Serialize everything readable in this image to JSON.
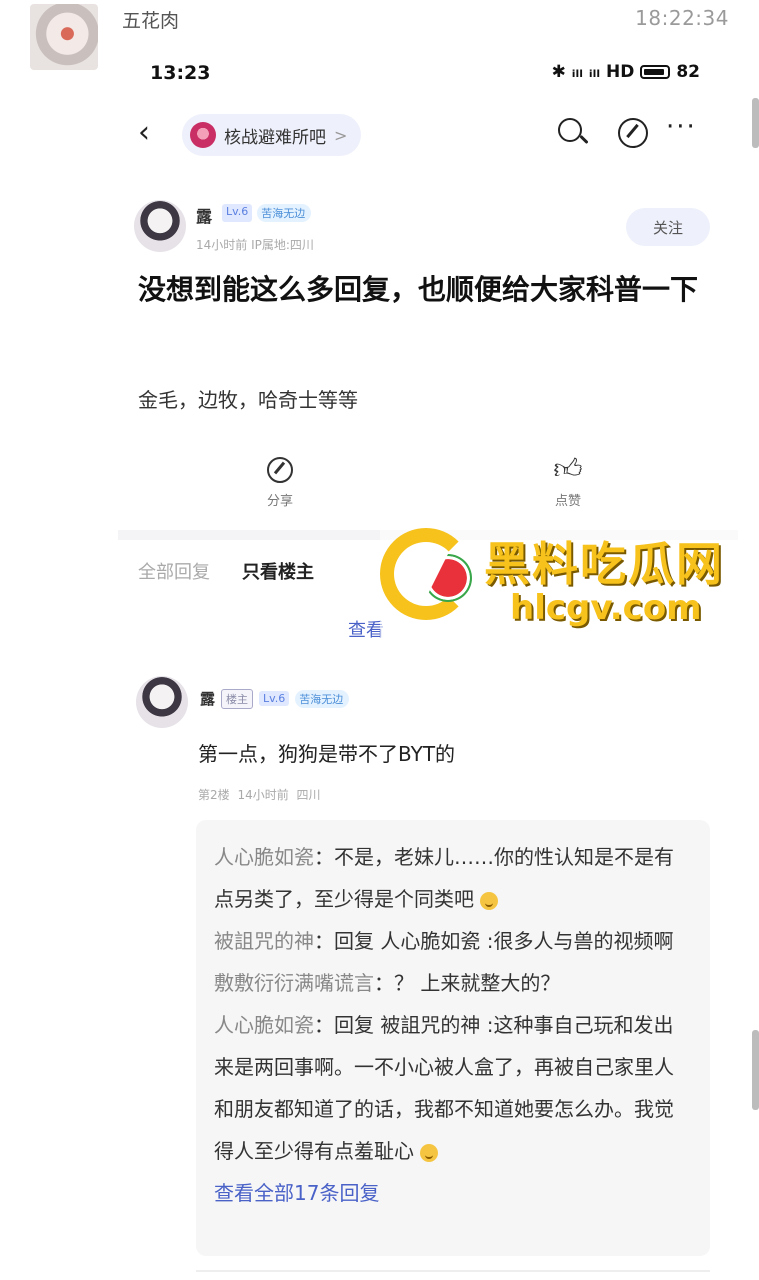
{
  "chat": {
    "sender_name": "五花肉",
    "time": "18:22:34"
  },
  "status_bar": {
    "time": "13:23",
    "icons_text": "✱ ᵢₗₗ ᵢₗₗ HD",
    "battery": "82"
  },
  "nav": {
    "back_symbol": "‹",
    "forum_name": "核战避难所吧",
    "forum_chevron": ">",
    "more_symbol": "···"
  },
  "post": {
    "author": "露",
    "level": "Lv.6",
    "honor": "苦海无边",
    "meta": "14小时前   IP属地:四川",
    "follow_label": "关注",
    "title": "没想到能这么多回复，也顺便给大家科普一下",
    "body": "金毛，边牧，哈奇士等等",
    "share_label": "分享",
    "like_label": "点赞"
  },
  "filters": {
    "all": "全部回复",
    "op_only": "只看楼主"
  },
  "view_previous": "查看",
  "watermark": {
    "title": "黑料吃瓜网",
    "url": "hlcgv.com"
  },
  "reply": {
    "author": "露",
    "host_badge": "楼主",
    "level": "Lv.6",
    "honor": "苦海无边",
    "text": "第一点，狗狗是带不了BYT的",
    "meta": "第2楼  14小时前  四川",
    "sub_replies": [
      {
        "user": "人心脆如瓷",
        "text": "：不是，老妹儿……你的性认知是不是有点另类了，至少得是个同类吧"
      },
      {
        "user": "被詛咒的神",
        "text": "：回复 人心脆如瓷 :很多人与兽的视频啊"
      },
      {
        "user": "敷敷衍衍满嘴谎言",
        "text": "：？ 上来就整大的？"
      },
      {
        "user": "人心脆如瓷",
        "text": "：回复 被詛咒的神 :这种事自己玩和发出来是两回事啊。一不小心被人盒了，再被自己家里人和朋友都知道了的话，我都不知道她要怎么办。我觉得人至少得有点羞耻心"
      }
    ],
    "see_all": "查看全部17条回复"
  }
}
